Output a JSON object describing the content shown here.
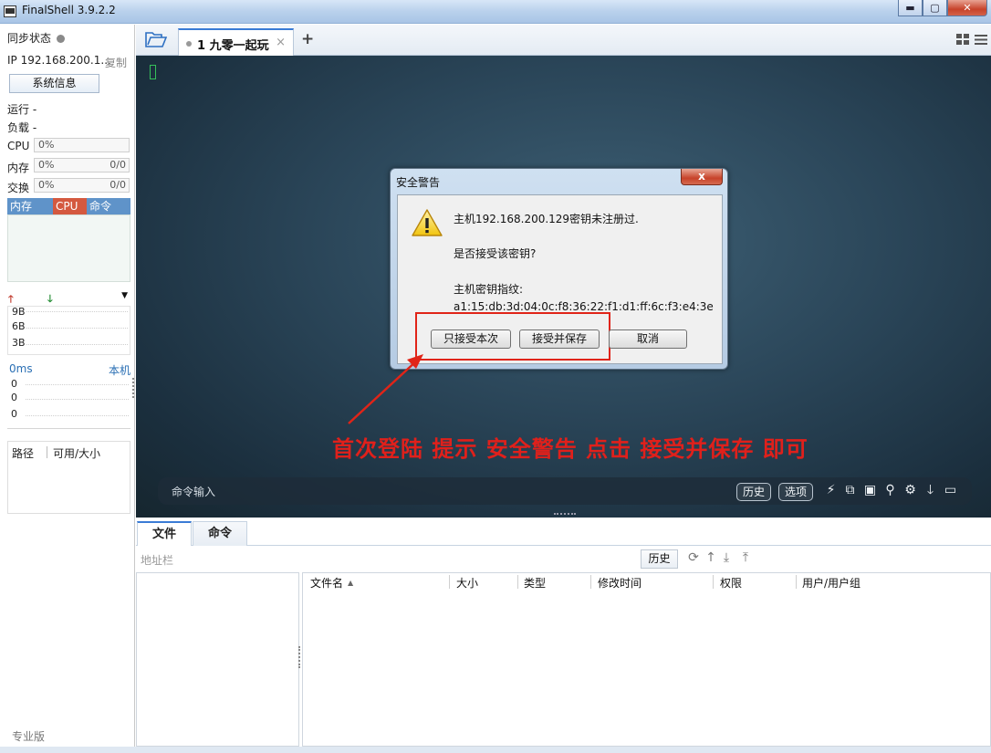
{
  "window": {
    "title": "FinalShell 3.9.2.2",
    "minimize": "▬",
    "maximize": "▢",
    "close": "✕"
  },
  "sidebar": {
    "sync_label": "同步状态",
    "ip_text": "IP 192.168.200.1...",
    "copy_label": "复制",
    "sysinfo_button": "系统信息",
    "run_label": "运行 -",
    "load_label": "负载 -",
    "cpu_label": "CPU",
    "cpu_value": "0%",
    "mem_label": "内存",
    "mem_value": "0%",
    "mem_total": "0/0",
    "swap_label": "交换",
    "swap_value": "0%",
    "swap_total": "0/0",
    "tabs": {
      "mem": "内存",
      "cpu": "CPU",
      "cmd": "命令"
    },
    "net_scale": [
      "9B",
      "6B",
      "3B"
    ],
    "latency_label": "0ms",
    "latency_host": "本机",
    "latency_values": [
      "0",
      "0",
      "0"
    ],
    "path_header": "路径",
    "size_header": "可用/大小",
    "edition": "专业版"
  },
  "tabbar": {
    "session_tab": "1 九零一起玩",
    "close_tab": "×",
    "add_tab": "+"
  },
  "terminal": {
    "command_placeholder": "命令输入",
    "history_button": "历史",
    "options_button": "选项",
    "annotation": "首次登陆 提示 安全警告 点击 接受并保存 即可"
  },
  "dialog": {
    "title": "安全警告",
    "close": "x",
    "line1": "主机192.168.200.129密钥未注册过.",
    "line2": "是否接受该密钥?",
    "line3": "主机密钥指纹:",
    "fingerprint": "a1:15:db:3d:04:0c:f8:36:22:f1:d1:ff:6c:f3:e4:3e",
    "accept_once": "只接受本次",
    "accept_save": "接受并保存",
    "cancel": "取消"
  },
  "files": {
    "tab_files": "文件",
    "tab_commands": "命令",
    "address_placeholder": "地址栏",
    "history_button": "历史",
    "columns": [
      "文件名",
      "大小",
      "类型",
      "修改时间",
      "权限",
      "用户/用户组"
    ]
  },
  "colors": {
    "accent": "#3a7bd5",
    "warning_red": "#e02418",
    "cpu_tab": "#d4593f",
    "mem_tab": "#5f93c9"
  }
}
